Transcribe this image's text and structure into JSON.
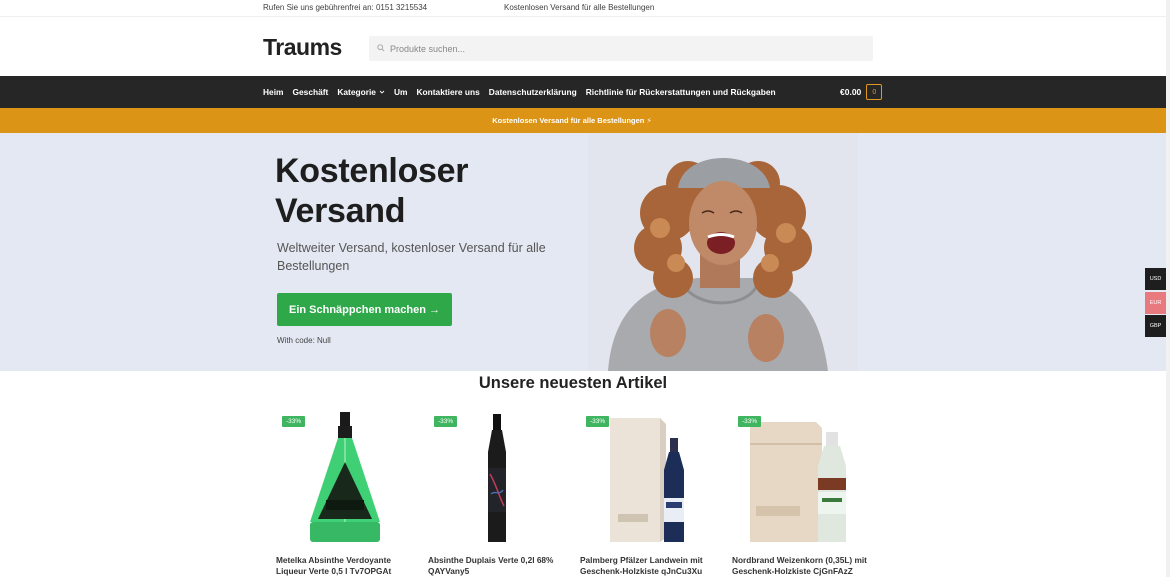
{
  "topbar": {
    "phone": "Rufen Sie uns gebührenfrei an: 0151 3215534",
    "shipping": "Kostenlosen Versand für alle Bestellungen"
  },
  "header": {
    "logo": "Traums",
    "search_placeholder": "Produkte suchen..."
  },
  "nav": {
    "items": [
      {
        "label": "Heim"
      },
      {
        "label": "Geschäft"
      },
      {
        "label": "Kategorie"
      },
      {
        "label": "Um"
      },
      {
        "label": "Kontaktiere uns"
      },
      {
        "label": "Datenschutzerklärung"
      },
      {
        "label": "Richtlinie für Rückerstattungen und Rückgaben"
      }
    ],
    "cart_amount": "€0.00",
    "cart_count": "0"
  },
  "promo": "Kostenlosen Versand für alle Bestellungen ⚡",
  "hero": {
    "title": "Kostenloser Versand",
    "subtitle": "Weltweiter Versand, kostenloser Versand für alle Bestellungen",
    "cta": "Ein Schnäppchen machen →",
    "code": "With code: Null"
  },
  "currency": [
    "USD",
    "EUR",
    "GBP"
  ],
  "colors": {
    "accent": "#dc9416",
    "nav_bg": "#262626",
    "cta": "#2fa84a",
    "hero_bg": "#e3e8f2"
  },
  "section_title": "Unsere neuesten Artikel",
  "products": [
    {
      "badge": "-33%",
      "name": "Metelka Absinthe Verdoyante Liqueur Verte 0,5 l Tv7OPGAt"
    },
    {
      "badge": "-33%",
      "name": "Absinthe Duplais Verte 0,2l 68% QAYVany5"
    },
    {
      "badge": "-33%",
      "name": "Palmberg Pfälzer Landwein mit Geschenk-Holzkiste qJnCu3Xu"
    },
    {
      "badge": "-33%",
      "name": "Nordbrand Weizenkorn (0,35L) mit Geschenk-Holzkiste CjGnFAzZ"
    }
  ]
}
